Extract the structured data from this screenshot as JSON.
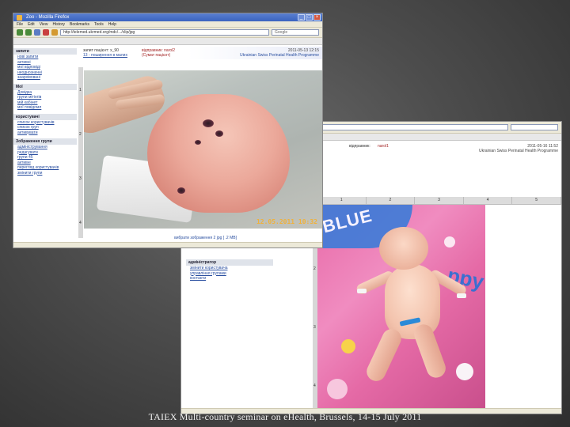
{
  "back_window": {
    "address": "",
    "header": {
      "sender_label": "відправник:",
      "sender_value": "narol1",
      "date_line": "2011-05-16 11:52",
      "program_line": "Ukrainian Swiss Perinatal Health Programme"
    },
    "columns": [
      "1",
      "2",
      "3",
      "4",
      "5"
    ],
    "row_numbers": [
      "1",
      "2",
      "3",
      "4"
    ],
    "sidebar": [
      {
        "heading": "адміністратор",
        "items": [
          "змінити користувача",
          "управління групами",
          "контакти"
        ]
      }
    ],
    "status_text": ""
  },
  "front_window": {
    "title": "Zoo - Mozilla Firefox",
    "menu": [
      "File",
      "Edit",
      "View",
      "History",
      "Bookmarks",
      "Tools",
      "Help"
    ],
    "address": "http://telemed.ukrmed.org/mdc/.../clip/jpg",
    "search_placeholder": "Google",
    "header": {
      "left_line1": "запит пацієнт: x_90",
      "left_line2": "13 - поширення в малих",
      "mid_line1": "відправник: narol2",
      "mid_line2": "(Сумат пацієнт)",
      "right_line1": "2011-05-13 12:15",
      "right_line2": "Ukrainian Swiss Perinatal Health Programme"
    },
    "sidebar": [
      {
        "heading": "запити",
        "items": [
          "нові запити",
          "активні",
          "мої відповіді",
          "неоднозначні",
          "заархівовані"
        ]
      },
      {
        "heading": "Мої",
        "items": [
          "Довідка",
          "групи мітінгів",
          "мій кабінет",
          "мої повідомл"
        ]
      },
      {
        "heading": "користувачі",
        "items": [
          "список користувачів",
          "список груп",
          "активувати"
        ]
      },
      {
        "heading": "Зображення групи",
        "items": [
          "адміністрування",
          "редагувати",
          "групи 45",
          "активні",
          "перегляд користувачів",
          "змінити групи"
        ]
      }
    ],
    "row_numbers": [
      "1",
      "2",
      "3",
      "4"
    ],
    "photo_timestamp": "12.05.2011   10:32",
    "footer_link": "вибрати зображення   2 jpg [  .2 MB]",
    "status_text": ""
  },
  "caption": "TAIEX Multi-country seminar on eHealth, Brussels, 14-15 July 2011"
}
